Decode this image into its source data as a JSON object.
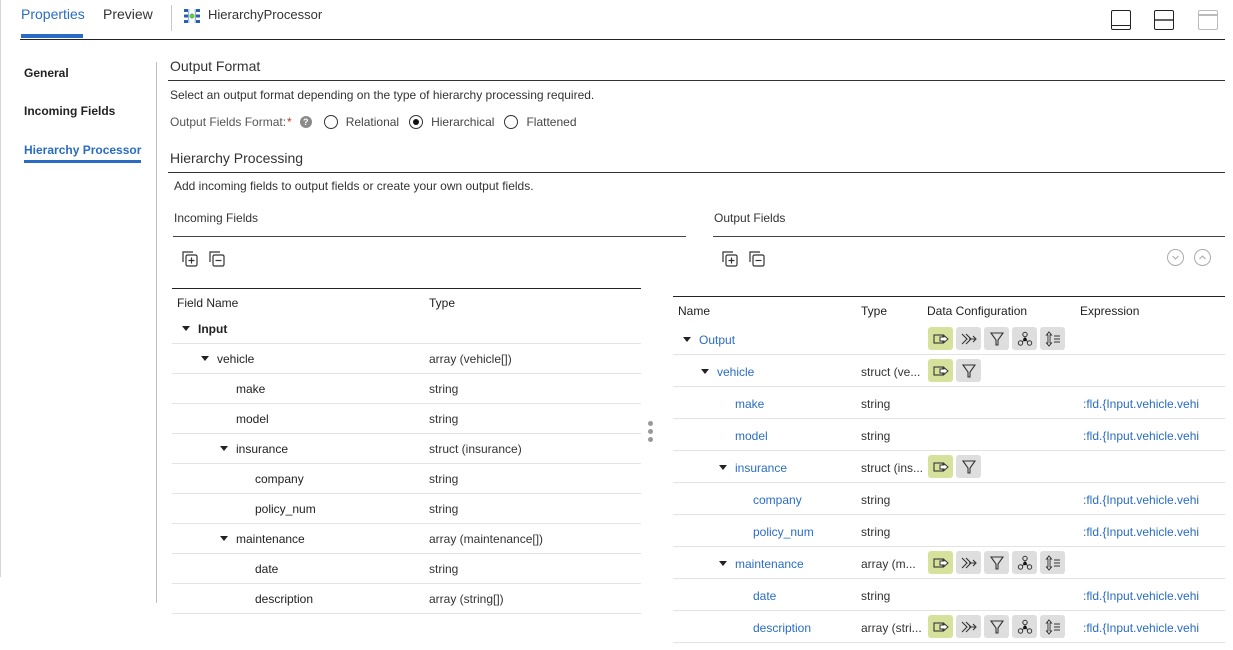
{
  "tabs": [
    {
      "label": "Properties",
      "active": true
    },
    {
      "label": "Preview",
      "active": false
    }
  ],
  "processor": {
    "icon": "hierarchy-processor-icon",
    "title": "HierarchyProcessor"
  },
  "layout_buttons": [
    "layout-bottom-panel-icon",
    "layout-split-panel-icon",
    "layout-top-panel-icon"
  ],
  "nav": [
    {
      "label": "General",
      "active": false
    },
    {
      "label": "Incoming Fields",
      "active": false
    },
    {
      "label": "Hierarchy Processor",
      "active": true
    }
  ],
  "output_format": {
    "title": "Output Format",
    "description": "Select an output format depending on the type of hierarchy processing required.",
    "field_label": "Output Fields Format:",
    "required_mark": "*",
    "help_glyph": "?",
    "options": [
      {
        "label": "Relational",
        "checked": false
      },
      {
        "label": "Hierarchical",
        "checked": true
      },
      {
        "label": "Flattened",
        "checked": false
      }
    ]
  },
  "hierarchy_processing": {
    "title": "Hierarchy Processing",
    "description": "Add incoming fields to output fields or create your own output fields."
  },
  "incoming": {
    "title": "Incoming Fields",
    "toolbar": [
      "expand-all-icon",
      "collapse-all-icon"
    ],
    "columns": [
      "Field Name",
      "Type"
    ],
    "rows": [
      {
        "name": "Input",
        "type": "",
        "level": 0,
        "expandable": true
      },
      {
        "name": "vehicle",
        "type": "array (vehicle[])",
        "level": 1,
        "expandable": true
      },
      {
        "name": "make",
        "type": "string",
        "level": 2,
        "expandable": false
      },
      {
        "name": "model",
        "type": "string",
        "level": 2,
        "expandable": false
      },
      {
        "name": "insurance",
        "type": "struct (insurance)",
        "level": 2,
        "expandable": true
      },
      {
        "name": "company",
        "type": "string",
        "level": 3,
        "expandable": false
      },
      {
        "name": "policy_num",
        "type": "string",
        "level": 3,
        "expandable": false
      },
      {
        "name": "maintenance",
        "type": "array (maintenance[])",
        "level": 2,
        "expandable": true
      },
      {
        "name": "date",
        "type": "string",
        "level": 3,
        "expandable": false
      },
      {
        "name": "description",
        "type": "array (string[])",
        "level": 3,
        "expandable": false
      }
    ]
  },
  "output": {
    "title": "Output Fields",
    "toolbar": [
      "expand-all-icon",
      "collapse-all-icon"
    ],
    "nav_buttons": [
      "move-down-icon",
      "move-up-icon"
    ],
    "columns": [
      "Name",
      "Type",
      "Data Configuration",
      "Expression"
    ],
    "rows": [
      {
        "name": "Output",
        "type": "",
        "level": 0,
        "expandable": true,
        "config": [
          "output",
          "join",
          "filter",
          "group",
          "sort"
        ],
        "expression": ""
      },
      {
        "name": "vehicle",
        "type": "struct (ve...",
        "level": 1,
        "expandable": true,
        "config": [
          "output",
          "filter"
        ],
        "expression": ""
      },
      {
        "name": "make",
        "type": "string",
        "level": 2,
        "expandable": false,
        "config": [],
        "expression": ":fld.{Input.vehicle.vehi"
      },
      {
        "name": "model",
        "type": "string",
        "level": 2,
        "expandable": false,
        "config": [],
        "expression": ":fld.{Input.vehicle.vehi"
      },
      {
        "name": "insurance",
        "type": "struct (ins...",
        "level": 2,
        "expandable": true,
        "config": [
          "output",
          "filter"
        ],
        "expression": ""
      },
      {
        "name": "company",
        "type": "string",
        "level": 3,
        "expandable": false,
        "config": [],
        "expression": ":fld.{Input.vehicle.vehi"
      },
      {
        "name": "policy_num",
        "type": "string",
        "level": 3,
        "expandable": false,
        "config": [],
        "expression": ":fld.{Input.vehicle.vehi"
      },
      {
        "name": "maintenance",
        "type": "array (m...",
        "level": 2,
        "expandable": true,
        "config": [
          "output",
          "join",
          "filter",
          "group",
          "sort"
        ],
        "expression": ""
      },
      {
        "name": "date",
        "type": "string",
        "level": 3,
        "expandable": false,
        "config": [],
        "expression": ":fld.{Input.vehicle.vehi"
      },
      {
        "name": "description",
        "type": "array (stri...",
        "level": 3,
        "expandable": false,
        "config": [
          "output",
          "join",
          "filter",
          "group",
          "sort"
        ],
        "expression": ":fld.{Input.vehicle.vehi"
      }
    ]
  },
  "colors": {
    "accent": "#2a6cc4",
    "config_active": "#d6e29b",
    "config_default": "#dedede",
    "required": "#d0312d"
  }
}
